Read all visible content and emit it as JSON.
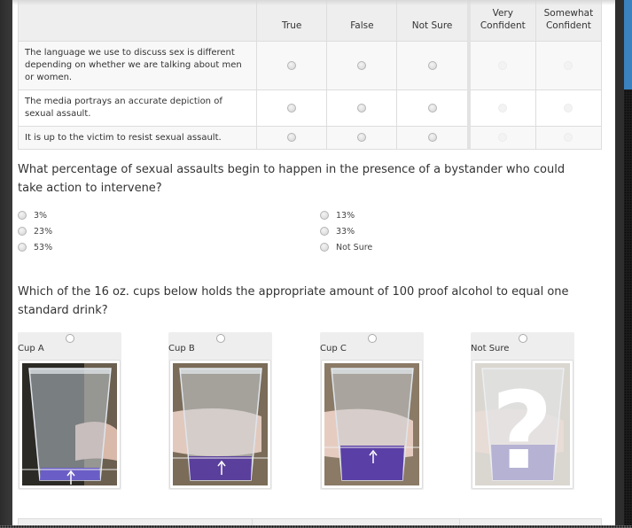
{
  "matrix": {
    "columns": [
      "True",
      "False",
      "Not Sure"
    ],
    "confidence_columns": [
      "Very Confident",
      "Somewhat Confident"
    ],
    "confidence_column_lines": [
      [
        "Very",
        "Confident"
      ],
      [
        "Somewhat",
        "Confident"
      ]
    ],
    "rows": [
      {
        "statement": "The language we use to discuss sex is different depending on whether we are talking about men or women."
      },
      {
        "statement": "The media portrays an accurate depiction of sexual assault."
      },
      {
        "statement": "It is up to the victim to resist sexual assault."
      }
    ]
  },
  "question_bystander": {
    "text": "What percentage of sexual assaults begin to happen in the presence of a bystander who could take action to intervene?",
    "options_left": [
      "3%",
      "23%",
      "53%"
    ],
    "options_right": [
      "13%",
      "33%",
      "Not Sure"
    ]
  },
  "question_cups": {
    "text": "Which of the 16 oz. cups below holds the appropriate amount of 100 proof alcohol to equal one standard drink?",
    "options": [
      {
        "label": "Cup A",
        "image": "cup-low-fill-photo"
      },
      {
        "label": "Cup B",
        "image": "cup-medium-fill-photo"
      },
      {
        "label": "Cup C",
        "image": "cup-high-fill-photo"
      },
      {
        "label": "Not Sure",
        "image": "question-mark-overlay-photo"
      }
    ],
    "not_sure_glyph": "?"
  },
  "colors": {
    "accent_blue": "#3a83c0",
    "liquid": "#5a4fb8"
  }
}
